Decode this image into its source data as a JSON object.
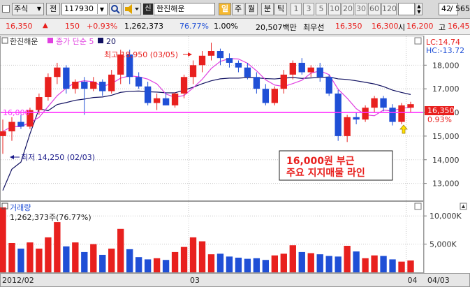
{
  "toolbar": {
    "market": "주식",
    "prefix": "전",
    "code": "117930",
    "sin_badge": "신",
    "name": "한진해운",
    "periods": [
      "일",
      "주",
      "월",
      "분",
      "틱"
    ],
    "active_period": "일",
    "minutes": [
      "1",
      "3",
      "5",
      "10",
      "20",
      "30",
      "60",
      "120"
    ],
    "count": "42",
    "total": "/ 565",
    "colors": {
      "active": "#f5b830"
    }
  },
  "quote": {
    "price": "16,350",
    "arrow": "▲",
    "change": "150",
    "change_pct": "+0.93%",
    "volume": "1,262,373",
    "vol_ratio": "76.77%",
    "rate": "1.00%",
    "amount": "20,507백만",
    "best_label": "최우선",
    "ask": "16,350",
    "bid": "16,300",
    "open_label": "시",
    "open": "16,200",
    "high_label": "고",
    "high": "16,45"
  },
  "chart_data": {
    "type": "candlestick",
    "price_panel": {
      "legend": [
        "한진해운",
        "종가 단순 5",
        "20"
      ],
      "high_label": "LC:14.74",
      "low_label": "HC:-13.72",
      "ylim": [
        12250,
        19250
      ],
      "y_ticks": [
        13000,
        14000,
        15000,
        16000,
        17000,
        18000
      ],
      "y_tick_labels": [
        "13,000",
        "14,000",
        "15,000",
        "16,000",
        "17,000",
        "18,000"
      ],
      "support_level": 16000,
      "support_label": "16,000",
      "current_price_label": "16,350",
      "current_pct_label": "0.93%",
      "max_annotation": "최고 18,950 (03/05)",
      "min_annotation": "최저 14,250 (02/03)",
      "note_lines": [
        "16,000원 부근",
        "주요 지지매물 라인"
      ],
      "candles": [
        {
          "o": 15000,
          "h": 15700,
          "l": 14250,
          "c": 15200
        },
        {
          "o": 15200,
          "h": 15800,
          "l": 14800,
          "c": 15600
        },
        {
          "o": 15600,
          "h": 15900,
          "l": 15300,
          "c": 15400
        },
        {
          "o": 15400,
          "h": 16200,
          "l": 15300,
          "c": 16100
        },
        {
          "o": 16100,
          "h": 16800,
          "l": 15900,
          "c": 16650
        },
        {
          "o": 16650,
          "h": 17650,
          "l": 16500,
          "c": 17500
        },
        {
          "o": 17500,
          "h": 18100,
          "l": 17200,
          "c": 17900
        },
        {
          "o": 17900,
          "h": 18000,
          "l": 16800,
          "c": 17000
        },
        {
          "o": 17000,
          "h": 17400,
          "l": 16800,
          "c": 17300
        },
        {
          "o": 17300,
          "h": 17500,
          "l": 15900,
          "c": 17000
        },
        {
          "o": 17000,
          "h": 17500,
          "l": 16900,
          "c": 17300
        },
        {
          "o": 17300,
          "h": 17400,
          "l": 16700,
          "c": 16900
        },
        {
          "o": 16900,
          "h": 17800,
          "l": 16800,
          "c": 17600
        },
        {
          "o": 17600,
          "h": 18650,
          "l": 17200,
          "c": 18450
        },
        {
          "o": 18450,
          "h": 18650,
          "l": 17200,
          "c": 17500
        },
        {
          "o": 17500,
          "h": 17700,
          "l": 17000,
          "c": 17100
        },
        {
          "o": 17100,
          "h": 17300,
          "l": 16300,
          "c": 16400
        },
        {
          "o": 16400,
          "h": 16800,
          "l": 16100,
          "c": 16600
        },
        {
          "o": 16600,
          "h": 16850,
          "l": 16300,
          "c": 16300
        },
        {
          "o": 16300,
          "h": 16850,
          "l": 16200,
          "c": 16800
        },
        {
          "o": 16800,
          "h": 17600,
          "l": 16600,
          "c": 17500
        },
        {
          "o": 17500,
          "h": 18200,
          "l": 17200,
          "c": 18000
        },
        {
          "o": 18000,
          "h": 18600,
          "l": 17700,
          "c": 18400
        },
        {
          "o": 18400,
          "h": 18950,
          "l": 18200,
          "c": 18600
        },
        {
          "o": 18600,
          "h": 18700,
          "l": 18000,
          "c": 18300
        },
        {
          "o": 18300,
          "h": 18500,
          "l": 17900,
          "c": 18100
        },
        {
          "o": 18100,
          "h": 18200,
          "l": 17700,
          "c": 17900
        },
        {
          "o": 17900,
          "h": 18100,
          "l": 17400,
          "c": 17500
        },
        {
          "o": 17500,
          "h": 17700,
          "l": 16800,
          "c": 17000
        },
        {
          "o": 17000,
          "h": 17200,
          "l": 16300,
          "c": 16400
        },
        {
          "o": 16400,
          "h": 17100,
          "l": 16300,
          "c": 17000
        },
        {
          "o": 17000,
          "h": 17800,
          "l": 16800,
          "c": 17600
        },
        {
          "o": 17600,
          "h": 18200,
          "l": 17400,
          "c": 18100
        },
        {
          "o": 18100,
          "h": 18300,
          "l": 17600,
          "c": 17700
        },
        {
          "o": 17700,
          "h": 18000,
          "l": 17500,
          "c": 17900
        },
        {
          "o": 17900,
          "h": 18100,
          "l": 17300,
          "c": 17500
        },
        {
          "o": 17500,
          "h": 17600,
          "l": 16700,
          "c": 16800
        },
        {
          "o": 16800,
          "h": 16950,
          "l": 14800,
          "c": 15000
        },
        {
          "o": 15000,
          "h": 15900,
          "l": 14750,
          "c": 15800
        },
        {
          "o": 15800,
          "h": 16000,
          "l": 15500,
          "c": 15700
        },
        {
          "o": 15700,
          "h": 16300,
          "l": 15600,
          "c": 16200
        },
        {
          "o": 16200,
          "h": 16700,
          "l": 16000,
          "c": 16600
        },
        {
          "o": 16600,
          "h": 16700,
          "l": 16050,
          "c": 16200
        },
        {
          "o": 16200,
          "h": 16350,
          "l": 15450,
          "c": 15600
        },
        {
          "o": 15600,
          "h": 16400,
          "l": 15500,
          "c": 16300
        },
        {
          "o": 16200,
          "h": 16450,
          "l": 16000,
          "c": 16350
        }
      ],
      "ma_colors": {
        "ma5": "#e040e0",
        "ma20": "#101060",
        "up": "#e8201e",
        "down": "#1f4fd6",
        "support": "#ff33ff"
      }
    },
    "volume_panel": {
      "title": "거래량",
      "volume_label": "1,262,373주(76.77%)",
      "ylim": [
        0,
        12500
      ],
      "y_ticks": [
        5000,
        10000
      ],
      "y_tick_labels": [
        "5,000K",
        "10,000K"
      ],
      "volumes_k": [
        11500,
        5200,
        4200,
        5300,
        4200,
        6200,
        8900,
        4600,
        5300,
        3600,
        5000,
        3100,
        4200,
        7700,
        4100,
        2700,
        2300,
        2500,
        2200,
        3600,
        4500,
        6200,
        5500,
        3200,
        3300,
        2800,
        2600,
        2400,
        2500,
        2200,
        3000,
        3300,
        4800,
        3600,
        3400,
        3200,
        2900,
        2800,
        4700,
        3700,
        2500,
        3000,
        2900,
        2300,
        1900,
        2100
      ]
    },
    "x_axis": {
      "labels": [
        "2012/02",
        "03",
        "04",
        "04/03"
      ],
      "label_index": [
        0,
        21,
        45,
        -1
      ]
    }
  }
}
